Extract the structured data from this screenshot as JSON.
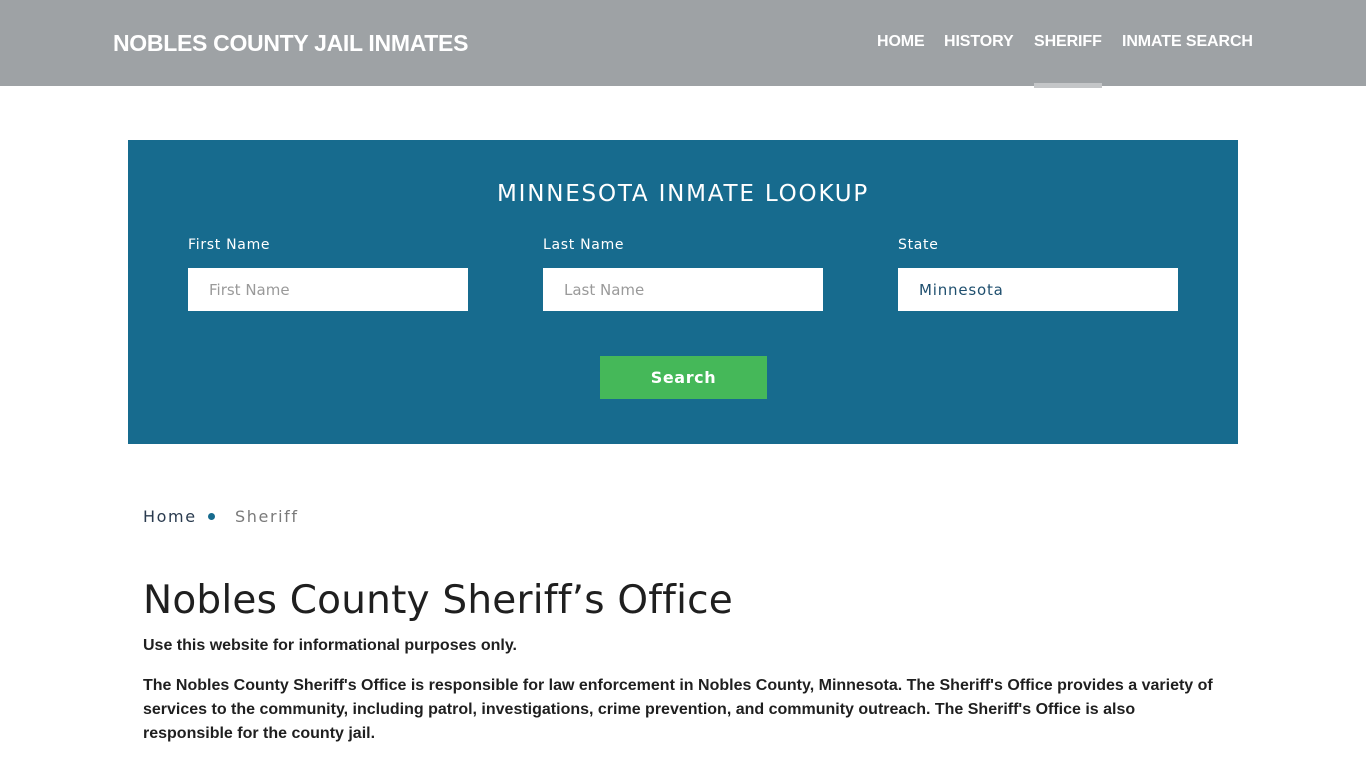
{
  "header": {
    "site_title": "NOBLES COUNTY JAIL INMATES",
    "nav": [
      {
        "label": "HOME",
        "active": false
      },
      {
        "label": "HISTORY",
        "active": false
      },
      {
        "label": "SHERIFF",
        "active": true
      },
      {
        "label": "INMATE SEARCH",
        "active": false
      }
    ]
  },
  "lookup": {
    "title": "MINNESOTA INMATE LOOKUP",
    "first_name": {
      "label": "First Name",
      "placeholder": "First Name",
      "value": ""
    },
    "last_name": {
      "label": "Last Name",
      "placeholder": "Last Name",
      "value": ""
    },
    "state": {
      "label": "State",
      "value": "Minnesota"
    },
    "search_label": "Search"
  },
  "breadcrumb": {
    "home": "Home",
    "current": "Sheriff"
  },
  "content": {
    "title": "Nobles County Sheriff’s Office",
    "disclaimer": "Use this website for informational purposes only.",
    "paragraph": "The Nobles County Sheriff's Office is responsible for law enforcement in Nobles County, Minnesota. The Sheriff's Office provides a variety of services to the community, including patrol, investigations, crime prevention, and community outreach. The Sheriff's Office is also responsible for the county jail."
  },
  "colors": {
    "header_bg": "#9ea2a5",
    "lookup_bg": "#176b8e",
    "search_button": "#45b859"
  }
}
